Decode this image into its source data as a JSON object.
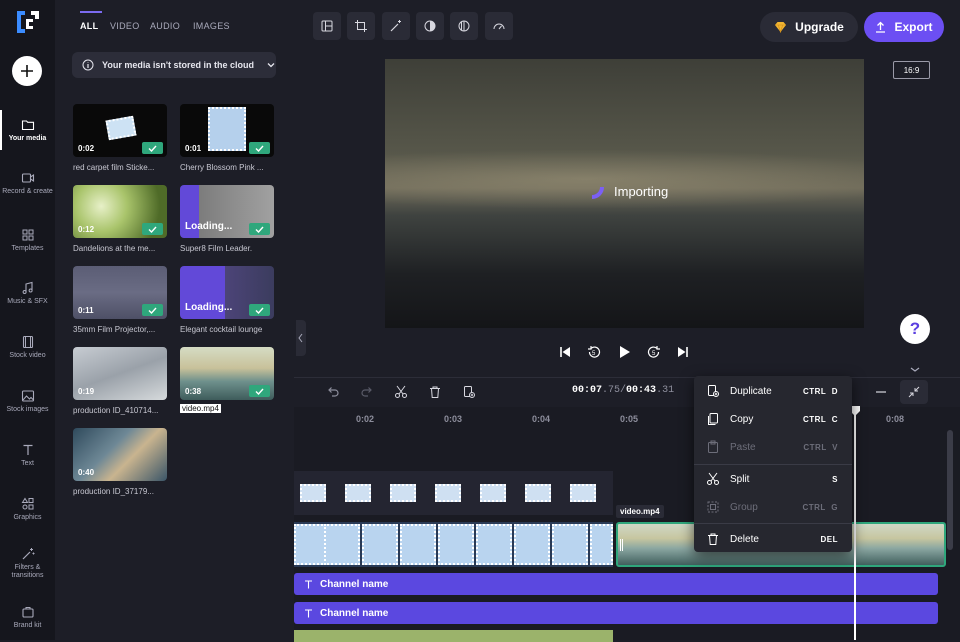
{
  "nav": {
    "items": [
      {
        "label": "Your media",
        "icon": "folder-icon"
      },
      {
        "label": "Record & create",
        "icon": "record-icon"
      },
      {
        "label": "Templates",
        "icon": "templates-icon"
      },
      {
        "label": "Music & SFX",
        "icon": "music-note-icon"
      },
      {
        "label": "Stock video",
        "icon": "film-icon"
      },
      {
        "label": "Stock images",
        "icon": "image-icon"
      },
      {
        "label": "Text",
        "icon": "text-icon"
      },
      {
        "label": "Graphics",
        "icon": "shapes-icon"
      },
      {
        "label": "Filters & transitions",
        "icon": "magic-wand-icon"
      },
      {
        "label": "Brand kit",
        "icon": "brand-kit-icon"
      }
    ]
  },
  "media": {
    "tabs": [
      "ALL",
      "VIDEO",
      "AUDIO",
      "IMAGES"
    ],
    "cloud_notice": "Your media isn't stored in the cloud",
    "items": [
      {
        "duration": "0:02",
        "caption": "red carpet film Sticke..."
      },
      {
        "duration": "0:01",
        "caption": "Cherry Blossom Pink ..."
      },
      {
        "duration": "0:12",
        "caption": "Dandelions at the me..."
      },
      {
        "status": "Loading...",
        "caption": "Super8 Film Leader."
      },
      {
        "duration": "0:11",
        "caption": "35mm Film Projector,..."
      },
      {
        "status": "Loading...",
        "caption": "Elegant cocktail lounge"
      },
      {
        "duration": "0:19",
        "caption": "production ID_410714..."
      },
      {
        "duration": "0:38",
        "caption": "video.mp4"
      },
      {
        "duration": "0:40",
        "caption": "production ID_37179..."
      }
    ]
  },
  "header": {
    "upgrade_label": "Upgrade",
    "export_label": "Export",
    "aspect_ratio": "16:9"
  },
  "preview": {
    "status": "Importing",
    "help_label": "?"
  },
  "timeline": {
    "current_time": "00:07",
    "current_frac": ".75",
    "separator": "/",
    "total_time": "00:43",
    "total_frac": ".31",
    "ruler": [
      "0:02",
      "0:03",
      "0:04",
      "0:05",
      "0:08"
    ],
    "clip_label": "video.mp4",
    "text_tracks": [
      "Channel name",
      "Channel name"
    ]
  },
  "context_menu": {
    "items": [
      {
        "label": "Duplicate",
        "shortcut_mod": "CTRL",
        "shortcut_key": "D",
        "enabled": true
      },
      {
        "label": "Copy",
        "shortcut_mod": "CTRL",
        "shortcut_key": "C",
        "enabled": true
      },
      {
        "label": "Paste",
        "shortcut_mod": "CTRL",
        "shortcut_key": "V",
        "enabled": false
      },
      {
        "label": "Split",
        "shortcut_mod": "",
        "shortcut_key": "S",
        "enabled": true
      },
      {
        "label": "Group",
        "shortcut_mod": "CTRL",
        "shortcut_key": "G",
        "enabled": false
      },
      {
        "label": "Delete",
        "shortcut_mod": "",
        "shortcut_key": "DEL",
        "enabled": true
      }
    ]
  },
  "colors": {
    "accent": "#6c4ff3",
    "success": "#2fa77c",
    "text_track": "#5b48e0"
  }
}
